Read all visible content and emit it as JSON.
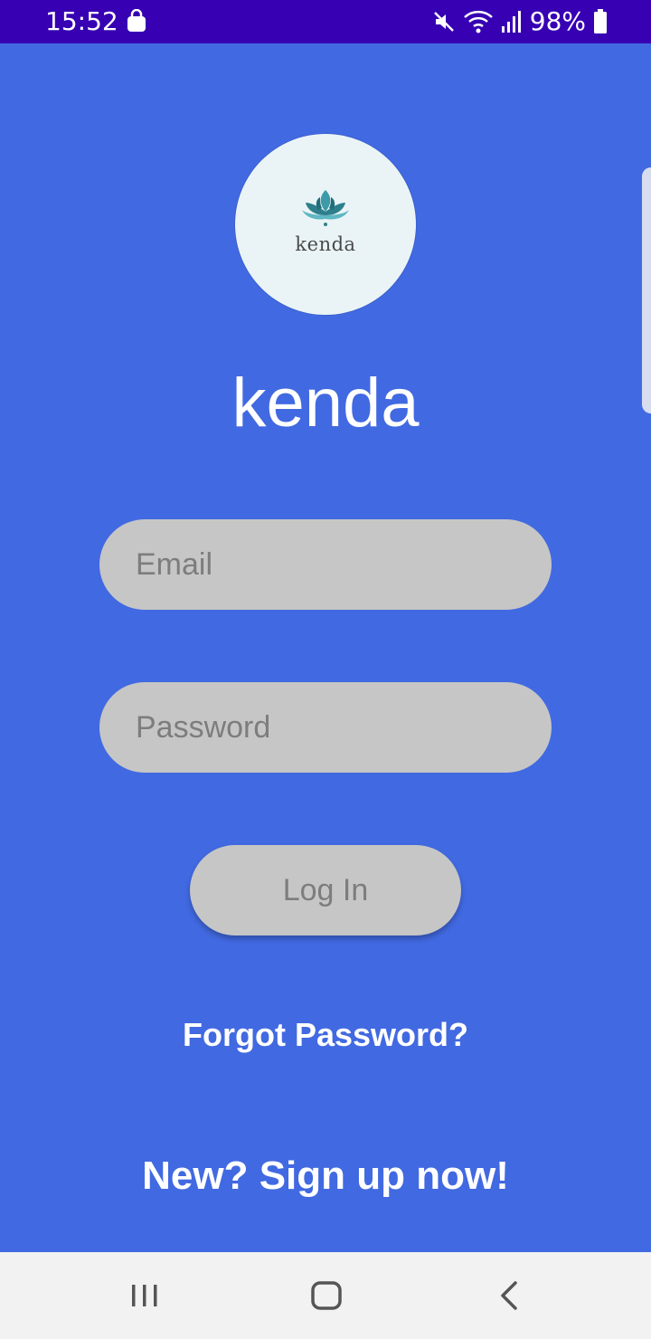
{
  "status_bar": {
    "time": "15:52",
    "battery": "98%",
    "icons": [
      "shopping-bag-icon",
      "mute-icon",
      "wifi-icon",
      "signal-icon",
      "battery-icon"
    ],
    "background": "#3700B3"
  },
  "logo": {
    "text": "kenda",
    "icon": "lotus-icon",
    "background": "#EAF4F6",
    "accent": "#3E9AA8"
  },
  "app": {
    "title": "kenda",
    "background": "#4169E1"
  },
  "form": {
    "email_placeholder": "Email",
    "email_value": "",
    "password_placeholder": "Password",
    "password_value": "",
    "login_label": "Log In",
    "field_color": "#C6C6C6"
  },
  "links": {
    "forgot_password": "Forgot Password?",
    "signup": "New? Sign up now!"
  },
  "nav_bar": {
    "buttons": [
      "recents-icon",
      "home-icon",
      "back-icon"
    ]
  }
}
